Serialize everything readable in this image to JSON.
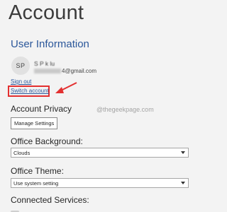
{
  "page": {
    "title": "Account"
  },
  "user_info": {
    "heading": "User Information",
    "avatar_initials": "SP",
    "name_visible": "S       P   k  lu",
    "email_visible": "4@gmail.com",
    "sign_out_label": "Sign out",
    "switch_account_label": "Switch account"
  },
  "privacy": {
    "heading": "Account Privacy",
    "manage_button_label": "Manage Settings"
  },
  "watermark": {
    "text": "@thegeekpage.com"
  },
  "office_background": {
    "heading": "Office Background:",
    "selected": "Clouds"
  },
  "office_theme": {
    "heading": "Office Theme:",
    "selected": "Use system setting"
  },
  "connected_services": {
    "heading": "Connected Services:"
  },
  "colors": {
    "accent": "#2b579a",
    "highlight": "#e33030",
    "background": "#f3f3f3"
  }
}
